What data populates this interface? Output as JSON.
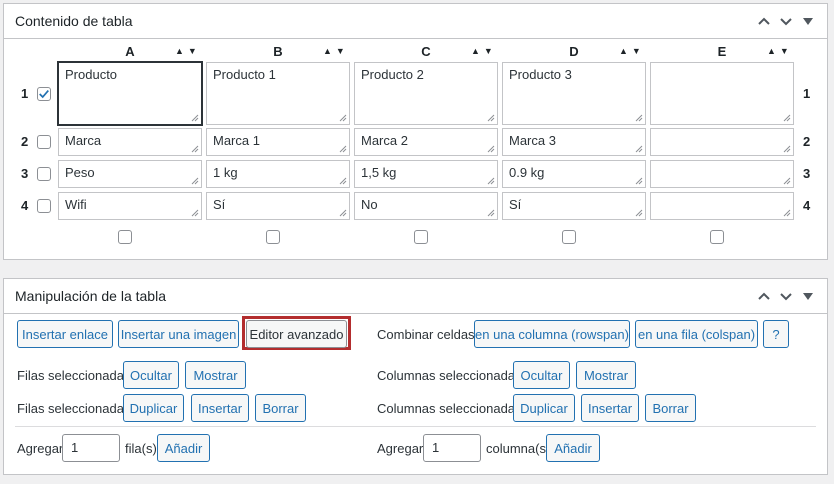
{
  "panel1": {
    "title": "Contenido de tabla",
    "columns": [
      "A",
      "B",
      "C",
      "D",
      "E"
    ],
    "row_numbers": [
      "1",
      "2",
      "3",
      "4"
    ],
    "rows": [
      [
        "Producto",
        "Producto 1",
        "Producto 2",
        "Producto 3",
        ""
      ],
      [
        "Marca",
        "Marca 1",
        "Marca 2",
        "Marca 3",
        ""
      ],
      [
        "Peso",
        "1 kg",
        "1,5 kg",
        "0.9 kg",
        ""
      ],
      [
        "Wifi",
        "Sí",
        "No",
        "Sí",
        ""
      ]
    ],
    "row_checked": [
      true,
      false,
      false,
      false
    ],
    "sort_glyph": "▲▼"
  },
  "panel2": {
    "title": "Manipulación de la tabla",
    "row1": {
      "insert_link": "Insertar enlace",
      "insert_image": "Insertar una imagen",
      "advanced_editor": "Editor avanzado",
      "combine_label": "Combinar celdas:",
      "rowspan": "en una columna (rowspan)",
      "colspan": "en una fila (colspan)",
      "help": "?"
    },
    "row2": {
      "rows_label": "Filas seleccionadas:",
      "hide": "Ocultar",
      "show": "Mostrar",
      "cols_label": "Columnas seleccionadas:",
      "col_hide": "Ocultar",
      "col_show": "Mostrar"
    },
    "row3": {
      "rows_label": "Filas seleccionadas:",
      "duplicate": "Duplicar",
      "insert": "Insertar",
      "delete": "Borrar",
      "cols_label": "Columnas seleccionadas:",
      "col_duplicate": "Duplicar",
      "col_insert": "Insertar",
      "col_delete": "Borrar"
    },
    "row4": {
      "add_label": "Agregar",
      "rows_value": "1",
      "rows_unit": "fila(s)",
      "add_rows": "Añadir",
      "add_label2": "Agregar",
      "cols_value": "1",
      "cols_unit": "columna(s)",
      "add_cols": "Añadir"
    }
  },
  "colors": {
    "accent": "#2271b1",
    "highlight": "#b32d2e",
    "border": "#c3c4c7"
  }
}
